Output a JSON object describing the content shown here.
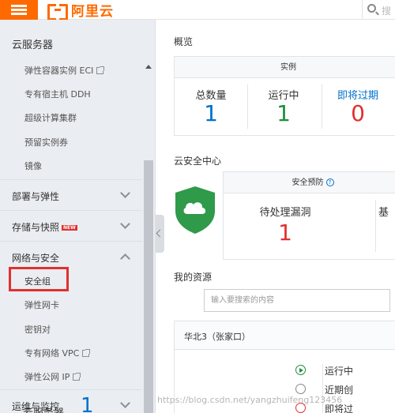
{
  "topbar": {
    "logo_text": "阿里云",
    "search_placeholder": "搜"
  },
  "sidebar": {
    "title": "云服务器",
    "top_items": [
      {
        "label": "弹性容器实例 ECI",
        "external": true
      },
      {
        "label": "专有宿主机 DDH"
      },
      {
        "label": "超级计算集群"
      },
      {
        "label": "预留实例券"
      },
      {
        "label": "镜像"
      }
    ],
    "groups": [
      {
        "label": "部署与弹性",
        "expanded": false
      },
      {
        "label": "存储与快照",
        "badge": "NEW",
        "expanded": false
      },
      {
        "label": "网络与安全",
        "expanded": true
      },
      {
        "label": "运维与监控",
        "expanded": false
      }
    ],
    "network_items": [
      {
        "label": "安全组",
        "highlighted": true
      },
      {
        "label": "弹性网卡"
      },
      {
        "label": "密钥对"
      },
      {
        "label": "专有网络 VPC",
        "external": true
      },
      {
        "label": "弹性公网 IP",
        "external": true
      }
    ]
  },
  "main": {
    "overview": {
      "title": "概览",
      "card_header": "实例",
      "stats": [
        {
          "label": "总数量",
          "value": "1",
          "color": "#0070cc"
        },
        {
          "label": "运行中",
          "value": "1",
          "color": "#1e8e3e"
        },
        {
          "label": "即将过期",
          "value": "0",
          "color": "#e0312f"
        }
      ]
    },
    "security": {
      "title": "云安全中心",
      "card_header": "安全预防",
      "help_icon": "?",
      "stat_label": "待处理漏洞",
      "stat_value": "1",
      "stat_color": "#e0312f",
      "truncated_label": "基"
    },
    "resources": {
      "title": "我的资源",
      "search_placeholder": "输入要搜索的内容",
      "region": "华北3（张家口）",
      "legend": [
        "运行中",
        "近期创",
        "即将过"
      ],
      "ecs_label": "云服务器",
      "ecs_count": "1"
    }
  },
  "watermark": "https://blog.csdn.net/yangzhuifeng123456"
}
